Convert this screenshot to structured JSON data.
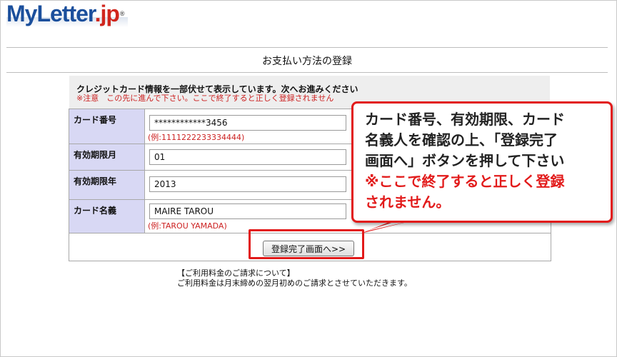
{
  "logo": {
    "main": "MyLetter",
    "suffix": ".jp",
    "reg": "®"
  },
  "page": {
    "title": "お支払い方法の登録"
  },
  "notice": {
    "line1": "クレジットカード情報を一部伏せて表示しています。次へお進みください",
    "line2": "※注意　この先に進んで下さい。ここで終了すると正しく登録されません"
  },
  "form": {
    "card_number": {
      "label": "カード番号",
      "value": "************3456",
      "example": "(例:1111222233334444)"
    },
    "expiry_month": {
      "label": "有効期限月",
      "value": "01"
    },
    "expiry_year": {
      "label": "有効期限年",
      "value": "2013"
    },
    "card_name": {
      "label": "カード名義",
      "value": "MAIRE TAROU",
      "example": "(例:TAROU YAMADA)"
    },
    "submit_label": "登録完了画面へ>>"
  },
  "billing": {
    "heading": "【ご利用料金のご請求について】",
    "text": "ご利用料金は月末締めの翌月初めのご請求とさせていただきます。"
  },
  "callout": {
    "line1": "カード番号、有効期限、カード",
    "line2": "名義人を確認の上、「登録完了",
    "line3": "画面へ」ボタンを押して下さい",
    "warn1": "※ここで終了すると正しく登録",
    "warn2": "されません。"
  },
  "colors": {
    "accent_red": "#e21a1a",
    "label_bg": "#d8d8f4",
    "logo_blue": "#1b4f9c"
  }
}
